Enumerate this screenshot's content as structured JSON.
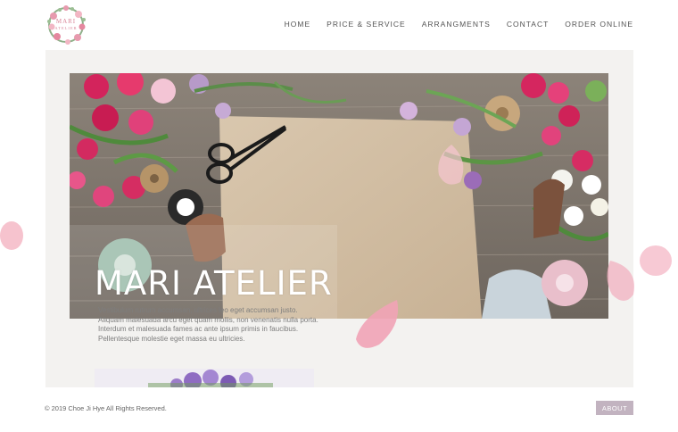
{
  "logo": {
    "text_top": "MARI",
    "text_bottom": "ATELIER"
  },
  "nav": {
    "items": [
      "HOME",
      "PRICE & SERVICE",
      "ARRANGMENTS",
      "CONTACT",
      "ORDER ONLINE"
    ]
  },
  "hero": {
    "title": "MARI ATELIER",
    "description": "Vestibulum rutrum accumsan, ultrices leo eget accumsan justo. Aliquam malesuada arcu eget quam mollis, non venenatis nulla porta. Interdum et malesuada fames ac ante ipsum primis in faucibus. Pellentesque molestie eget massa eu ultricies."
  },
  "footer": {
    "copyright": "© 2019 Choe Ji Hye All Rights Reserved.",
    "about_button": "ABOUT"
  },
  "colors": {
    "accent": "#c2b3c0",
    "petal": "#f4b8c6",
    "panel_bg": "#f3f2f0"
  }
}
